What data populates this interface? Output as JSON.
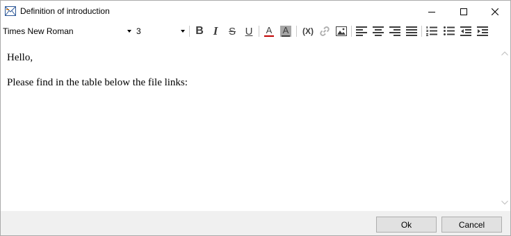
{
  "window": {
    "title": "Definition of introduction",
    "controls": [
      "minimize-icon",
      "maximize-icon",
      "close-icon"
    ]
  },
  "toolbar": {
    "font_family": "Times New Roman",
    "font_size": "3",
    "buttons": [
      "bold-icon",
      "italic-icon",
      "strikethrough-icon",
      "underline-icon",
      "font-color-icon",
      "highlight-color-icon",
      "insert-variable-icon",
      "insert-link-icon",
      "insert-image-icon",
      "align-left-icon",
      "align-center-icon",
      "align-right-icon",
      "justify-icon",
      "numbered-list-icon",
      "bulleted-list-icon",
      "outdent-icon",
      "indent-icon"
    ],
    "variable_label": "(X)",
    "bold_label": "B",
    "italic_label": "I",
    "strike_label": "S",
    "underline_label": "U",
    "color_label": "A",
    "highlight_label": "A"
  },
  "editor": {
    "paragraphs": [
      "Hello,",
      "Please find in the table below the file links:"
    ]
  },
  "footer": {
    "ok_label": "Ok",
    "cancel_label": "Cancel"
  },
  "colors": {
    "font_color_bar": "#c00000",
    "highlight_bg": "#a6a6a6",
    "toolbar_icon": "#3c3c3c",
    "footer_bg": "#f0f0f0"
  }
}
